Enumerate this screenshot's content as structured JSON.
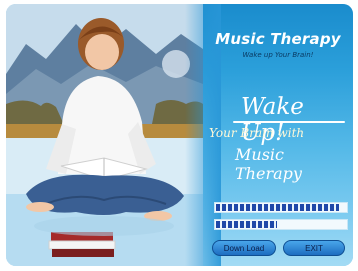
{
  "app": {
    "title": "Music Therapy",
    "subtitle": "Wake up Your Brain!"
  },
  "headline": {
    "wake_up": "Wake Up!",
    "line1": "Your Brain with",
    "line2": "Music Therapy"
  },
  "progress": {
    "bar1_fraction": 0.95,
    "bar2_fraction": 0.48
  },
  "buttons": {
    "download_label": "Down Load",
    "exit_label": "EXIT"
  },
  "colors": {
    "panel_blue": "#2b9fda",
    "progress_blue": "#1f48a8"
  }
}
